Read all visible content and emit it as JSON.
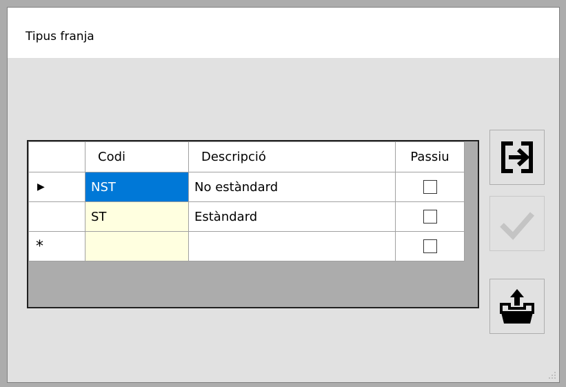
{
  "window": {
    "title": "Tipus franja"
  },
  "grid": {
    "columns": {
      "code": "Codi",
      "description": "Descripció",
      "passive": "Passiu"
    },
    "rows": [
      {
        "indicator": "current-row",
        "code": "NST",
        "description": "No estàndard",
        "passive": false,
        "selected": true
      },
      {
        "indicator": "",
        "code": "ST",
        "description": "Estàndard",
        "passive": false,
        "selected": false
      },
      {
        "indicator": "new-row",
        "code": "",
        "description": "",
        "passive": false,
        "selected": false
      }
    ],
    "new_row_marker": "*"
  },
  "toolbar": {
    "exit_button": {
      "icon": "exit-arrow-icon",
      "enabled": true
    },
    "accept_button": {
      "icon": "checkmark-icon",
      "enabled": false
    },
    "export_button": {
      "icon": "folder-upload-icon",
      "enabled": true
    }
  },
  "colors": {
    "selection": "#0078d7",
    "code_cell_bg": "#ffffe0",
    "window_bg": "#e1e1e1",
    "grid_empty_bg": "#acacac"
  }
}
